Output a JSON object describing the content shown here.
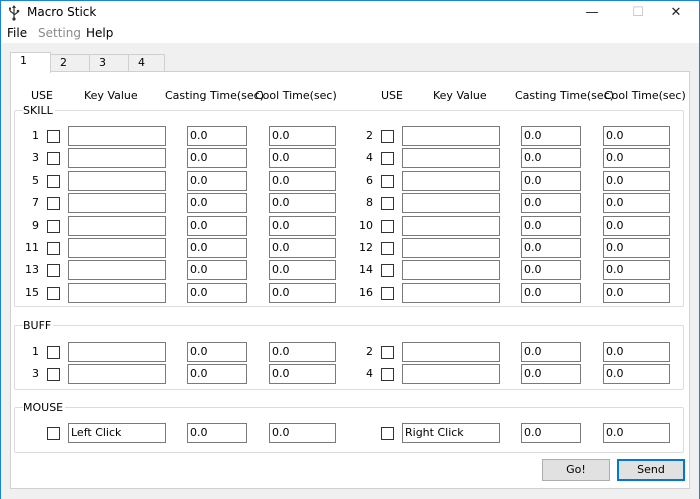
{
  "window": {
    "title": "Macro Stick"
  },
  "titlebar": {
    "minimize": "—",
    "maximize": "☐",
    "close": "✕"
  },
  "menu": {
    "file": "File",
    "setting": "Setting",
    "help": "Help"
  },
  "tabs": [
    "1",
    "2",
    "3",
    "4"
  ],
  "headers": {
    "use": "USE",
    "key_value": "Key Value",
    "casting_time": "Casting Time(sec)",
    "cool_time": "Cool Time(sec)"
  },
  "groups": {
    "skill": "SKILL",
    "buff": "BUFF",
    "mouse": "MOUSE"
  },
  "skill_rows": [
    {
      "left": {
        "num": "1",
        "key": "",
        "cast": "0.0",
        "cool": "0.0"
      },
      "right": {
        "num": "2",
        "key": "",
        "cast": "0.0",
        "cool": "0.0"
      }
    },
    {
      "left": {
        "num": "3",
        "key": "",
        "cast": "0.0",
        "cool": "0.0"
      },
      "right": {
        "num": "4",
        "key": "",
        "cast": "0.0",
        "cool": "0.0"
      }
    },
    {
      "left": {
        "num": "5",
        "key": "",
        "cast": "0.0",
        "cool": "0.0"
      },
      "right": {
        "num": "6",
        "key": "",
        "cast": "0.0",
        "cool": "0.0"
      }
    },
    {
      "left": {
        "num": "7",
        "key": "",
        "cast": "0.0",
        "cool": "0.0"
      },
      "right": {
        "num": "8",
        "key": "",
        "cast": "0.0",
        "cool": "0.0"
      }
    },
    {
      "left": {
        "num": "9",
        "key": "",
        "cast": "0.0",
        "cool": "0.0"
      },
      "right": {
        "num": "10",
        "key": "",
        "cast": "0.0",
        "cool": "0.0"
      }
    },
    {
      "left": {
        "num": "11",
        "key": "",
        "cast": "0.0",
        "cool": "0.0"
      },
      "right": {
        "num": "12",
        "key": "",
        "cast": "0.0",
        "cool": "0.0"
      }
    },
    {
      "left": {
        "num": "13",
        "key": "",
        "cast": "0.0",
        "cool": "0.0"
      },
      "right": {
        "num": "14",
        "key": "",
        "cast": "0.0",
        "cool": "0.0"
      }
    },
    {
      "left": {
        "num": "15",
        "key": "",
        "cast": "0.0",
        "cool": "0.0"
      },
      "right": {
        "num": "16",
        "key": "",
        "cast": "0.0",
        "cool": "0.0"
      }
    }
  ],
  "buff_rows": [
    {
      "left": {
        "num": "1",
        "key": "",
        "cast": "0.0",
        "cool": "0.0"
      },
      "right": {
        "num": "2",
        "key": "",
        "cast": "0.0",
        "cool": "0.0"
      }
    },
    {
      "left": {
        "num": "3",
        "key": "",
        "cast": "0.0",
        "cool": "0.0"
      },
      "right": {
        "num": "4",
        "key": "",
        "cast": "0.0",
        "cool": "0.0"
      }
    }
  ],
  "mouse": {
    "left": {
      "key": "Left Click",
      "cast": "0.0",
      "cool": "0.0"
    },
    "right": {
      "key": "Right Click",
      "cast": "0.0",
      "cool": "0.0"
    }
  },
  "buttons": {
    "go": "Go!",
    "send": "Send"
  }
}
